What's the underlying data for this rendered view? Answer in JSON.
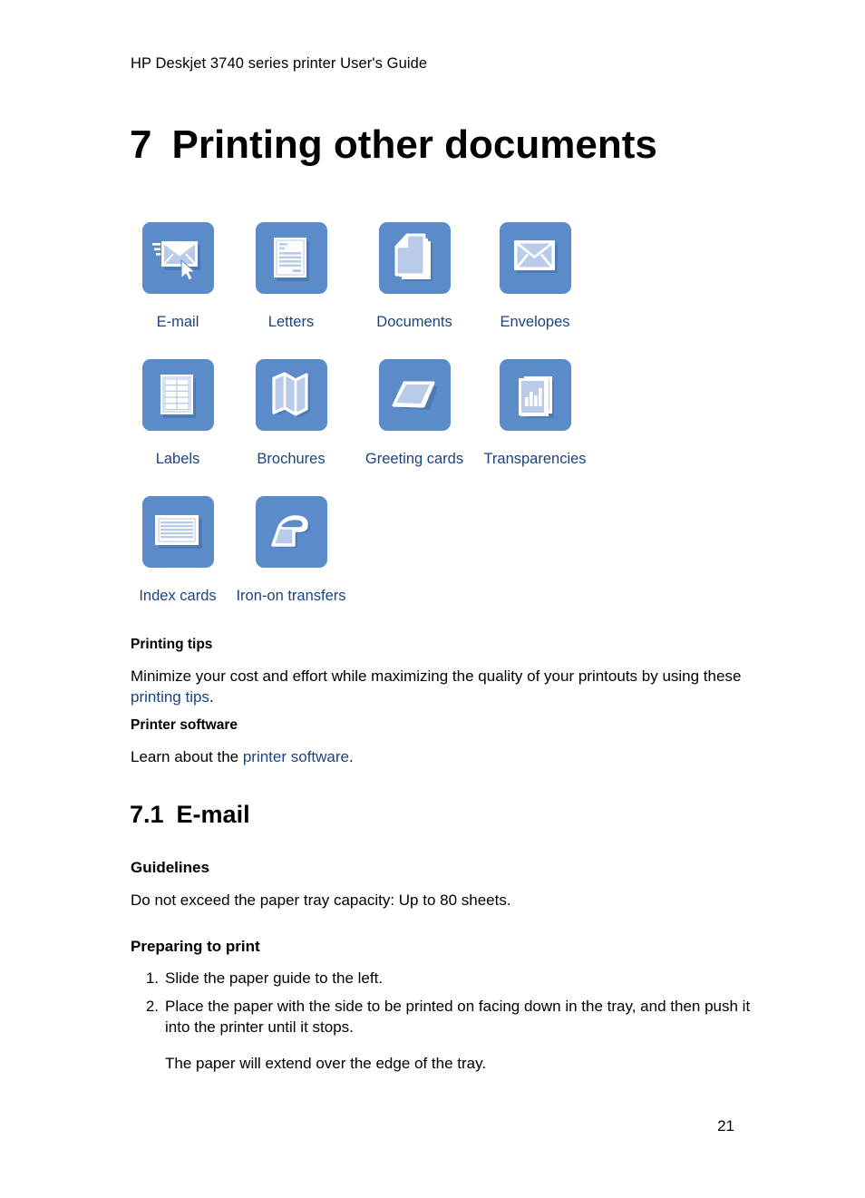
{
  "document": {
    "header": "HP Deskjet 3740 series printer User's Guide",
    "page_number": "21"
  },
  "chapter": {
    "number": "7",
    "title": "Printing other documents"
  },
  "icon_grid": {
    "rows": [
      [
        {
          "label": "E-mail",
          "icon": "email-envelope-cursor-icon"
        },
        {
          "label": "Letters",
          "icon": "letter-document-icon"
        },
        {
          "label": "Documents",
          "icon": "stacked-pages-icon"
        },
        {
          "label": "Envelopes",
          "icon": "envelope-icon"
        }
      ],
      [
        {
          "label": "Labels",
          "icon": "label-sheet-grid-icon"
        },
        {
          "label": "Brochures",
          "icon": "folded-brochure-icon"
        },
        {
          "label": "Greeting cards",
          "icon": "folded-greeting-card-icon"
        },
        {
          "label": "Transparencies",
          "icon": "transparency-chart-sheets-icon"
        }
      ],
      [
        {
          "label": "Index cards",
          "icon": "index-card-lines-icon"
        },
        {
          "label": "Iron-on transfers",
          "icon": "clothes-iron-icon"
        }
      ]
    ]
  },
  "sections": {
    "printing_tips": {
      "heading": "Printing tips",
      "text_before": "Minimize your cost and effort while maximizing the quality of your printouts by using these ",
      "link": "printing tips",
      "text_after": "."
    },
    "printer_software": {
      "heading": "Printer software",
      "text_before": "Learn about the ",
      "link": "printer software",
      "text_after": "."
    },
    "email": {
      "number": "7.1",
      "title": "E-mail",
      "guidelines_heading": "Guidelines",
      "guidelines_text": "Do not exceed the paper tray capacity: Up to 80 sheets.",
      "preparing_heading": "Preparing to print",
      "steps": [
        {
          "num": "1.",
          "text": "Slide the paper guide to the left."
        },
        {
          "num": "2.",
          "text": "Place the paper with the side to be printed on facing down in the tray, and then push it into the printer until it stops."
        }
      ],
      "step_note": "The paper will extend over the edge of the tray."
    }
  },
  "colors": {
    "link": "#1a4480",
    "icon_tile": "#5b8bc9",
    "icon_art_light": "#b9cbe8",
    "icon_art_white": "#ffffff"
  }
}
